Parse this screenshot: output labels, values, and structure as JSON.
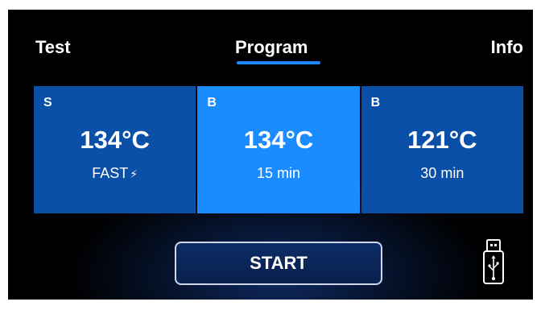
{
  "tabs": {
    "test": "Test",
    "program": "Program",
    "info": "Info",
    "active": "Program"
  },
  "programs": [
    {
      "type": "S",
      "temperature": "134°C",
      "detail": "FAST",
      "detail_icon": "lightning-bolt-icon",
      "selected": false
    },
    {
      "type": "B",
      "temperature": "134°C",
      "detail": "15 min",
      "selected": true
    },
    {
      "type": "B",
      "temperature": "121°C",
      "detail": "30 min",
      "selected": false
    }
  ],
  "start_label": "START",
  "usb_icon": "usb-drive-icon",
  "colors": {
    "background": "#000000",
    "card": "#0a4fa8",
    "card_selected": "#1a8cff",
    "accent": "#1e88ff",
    "text": "#ffffff"
  }
}
